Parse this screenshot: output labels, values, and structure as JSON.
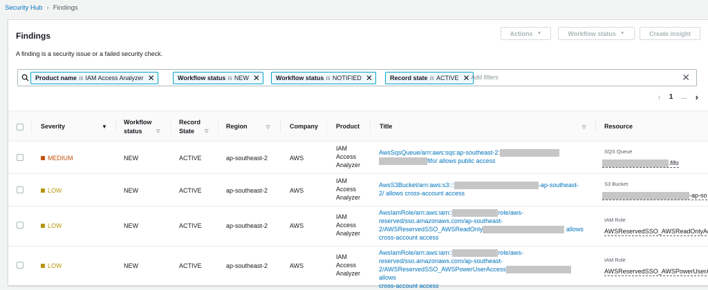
{
  "breadcrumb": {
    "root": "Security Hub",
    "current": "Findings"
  },
  "panel": {
    "title": "Findings",
    "description": "A finding is a security issue or a failed security check.",
    "buttons": {
      "actions": "Actions",
      "workflow": "Workflow status",
      "insight": "Create insight"
    }
  },
  "filters": {
    "tokens": [
      {
        "key": "Product name",
        "op": "is",
        "value": "IAM Access Analyzer"
      },
      {
        "key": "Workflow status",
        "op": "is",
        "value": "NEW"
      },
      {
        "key": "Workflow status",
        "op": "is",
        "value": "NOTIFIED"
      },
      {
        "key": "Record state",
        "op": "is",
        "value": "ACTIVE"
      }
    ],
    "placeholder": "Add filters"
  },
  "pager": {
    "current": "1",
    "ellipsis": "..."
  },
  "columns": {
    "severity": "Severity",
    "workflow_status": "Workflow status",
    "record_state": "Record State",
    "region": "Region",
    "company": "Company",
    "product": "Product",
    "title": "Title",
    "resource": "Resource"
  },
  "rows": [
    {
      "severity": "MEDIUM",
      "workflow": "NEW",
      "record": "ACTIVE",
      "region": "ap-southeast-2",
      "company": "AWS",
      "product": "IAM Access Analyzer",
      "title_parts": [
        "AwsSqsQueue/arn:aws:sqs:ap-southeast-2:",
        "fifo/ allows public access"
      ],
      "resource_type": "SQS Queue",
      "resource_name": ".fifo"
    },
    {
      "severity": "LOW",
      "workflow": "NEW",
      "record": "ACTIVE",
      "region": "ap-southeast-2",
      "company": "AWS",
      "product": "IAM Access Analyzer",
      "title_parts": [
        "AwsS3Bucket/arn:aws:s3:::",
        "-ap-southeast-",
        "2/ allows cross-account access"
      ],
      "resource_type": "S3 Bucket",
      "resource_name": "-ap-so"
    },
    {
      "severity": "LOW",
      "workflow": "NEW",
      "record": "ACTIVE",
      "region": "ap-southeast-2",
      "company": "AWS",
      "product": "IAM Access Analyzer",
      "title_parts": [
        "AwsIamRole/arn:aws:iam::",
        "role/aws-",
        "reserved/sso.amazonaws.com/ap-southeast-",
        "2/AWSReservedSSO_AWSReadOnly",
        "allows",
        "cross-account access"
      ],
      "resource_type": "IAM Role",
      "resource_name": "AWSReservedSSO_AWSReadOnlyAc"
    },
    {
      "severity": "LOW",
      "workflow": "NEW",
      "record": "ACTIVE",
      "region": "ap-southeast-2",
      "company": "AWS",
      "product": "IAM Access Analyzer",
      "title_parts": [
        "AwsIamRole/arn:aws:iam::",
        "role/aws-",
        "reserved/sso.amazonaws.com/ap-southeast-",
        "2/AWSReservedSSO_AWSPowerUserAccess",
        "allows",
        "cross-account access"
      ],
      "resource_type": "IAM Role",
      "resource_name": "AWSReservedSSO_AWSPowerUserA"
    }
  ],
  "colors": {
    "link": "#0073bb",
    "medium": "#c45209",
    "low": "#b7950b",
    "token_border": "#00a1c9"
  }
}
